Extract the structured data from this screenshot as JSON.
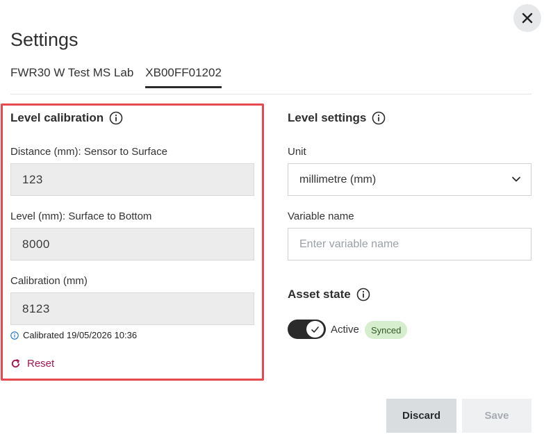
{
  "dialog": {
    "title": "Settings",
    "close_icon": "close-icon"
  },
  "tabs": [
    {
      "label": "FWR30 W Test MS Lab",
      "active": false
    },
    {
      "label": "XB00FF01202",
      "active": true
    }
  ],
  "level_calibration": {
    "heading": "Level calibration",
    "distance_label": "Distance (mm): Sensor to Surface",
    "distance_value": "123",
    "level_label": "Level (mm): Surface to Bottom",
    "level_value": "8000",
    "calibration_label": "Calibration (mm)",
    "calibration_value": "8123",
    "calibrated_text": "Calibrated 19/05/2026 10:36",
    "reset_label": "Reset",
    "highlight_color": "#e5484d"
  },
  "level_settings": {
    "heading": "Level settings",
    "unit_label": "Unit",
    "unit_value": "millimetre (mm)",
    "variable_label": "Variable name",
    "variable_placeholder": "Enter variable name",
    "variable_value": ""
  },
  "asset_state": {
    "heading": "Asset state",
    "toggle_on": true,
    "toggle_label": "Active",
    "badge": "Synced"
  },
  "footer": {
    "discard_label": "Discard",
    "save_label": "Save"
  },
  "colors": {
    "accent_reset": "#a5164e",
    "badge_bg": "#d6edce",
    "info_blue": "#1a73c9"
  }
}
